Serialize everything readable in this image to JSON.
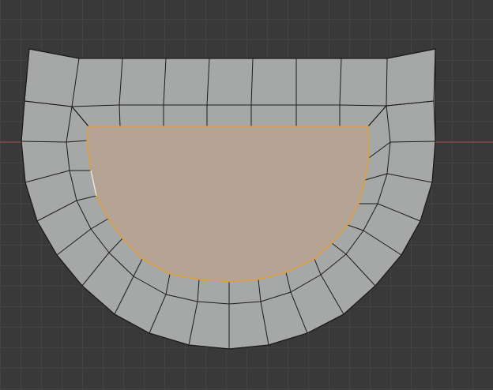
{
  "viewport": {
    "title": "",
    "background": "#393939",
    "grid_color": "#434343",
    "x_axis_color": "#a84b4b",
    "mesh_fill": "#a6a8a7",
    "edge_color": "#1b1b1b",
    "selected_face_fill": "#b5a393",
    "selected_edge_color": "#e69b2c",
    "mode": "edit-mode-face-select",
    "selected_faces": 1
  }
}
